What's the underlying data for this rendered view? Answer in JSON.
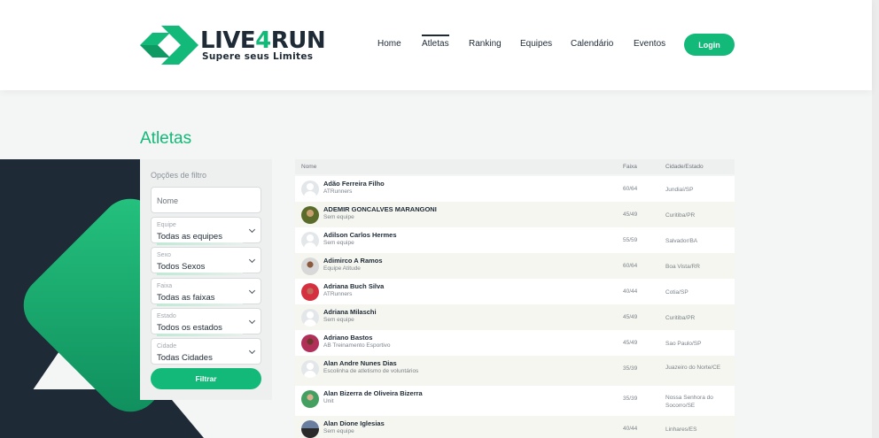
{
  "header": {
    "logo": {
      "name_part1": "LIVE",
      "name_part2": "4",
      "name_part3": "RUN",
      "tagline": "Supere seus Limites"
    },
    "nav": [
      "Home",
      "Atletas",
      "Ranking",
      "Equipes",
      "Calendário",
      "Eventos"
    ],
    "active_nav": "Atletas",
    "login_label": "Login"
  },
  "page": {
    "title": "Atletas"
  },
  "filters": {
    "title": "Opções de filtro",
    "name_placeholder": "Nome",
    "selects": [
      {
        "caption": "Equipe",
        "value": "Todas as equipes"
      },
      {
        "caption": "Sexo",
        "value": "Todos Sexos"
      },
      {
        "caption": "Faixa",
        "value": "Todas as faixas"
      },
      {
        "caption": "Estado",
        "value": "Todos os estados"
      },
      {
        "caption": "Cidade",
        "value": "Todas Cidades"
      }
    ],
    "submit_label": "Filtrar"
  },
  "table": {
    "headers": {
      "name": "Nome",
      "band": "Faixa",
      "city": "Cidade/Estado"
    },
    "rows": [
      {
        "name": "Adão Ferreira Filho",
        "team": "ATRunners",
        "band": "60/64",
        "city": "Jundiaí/SP"
      },
      {
        "name": "ADEMIR GONCALVES MARANGONI",
        "team": "Sem equipe",
        "band": "45/49",
        "city": "Curitiba/PR"
      },
      {
        "name": "Adilson Carlos Hermes",
        "team": "Sem equipe",
        "band": "55/59",
        "city": "Salvador/BA"
      },
      {
        "name": "Adimirco A Ramos",
        "team": "Equipe Atitude",
        "band": "60/64",
        "city": "Boa Vista/RR"
      },
      {
        "name": "Adriana Buch Silva",
        "team": "ATRunners",
        "band": "40/44",
        "city": "Cotia/SP"
      },
      {
        "name": "Adriana Milaschi",
        "team": "Sem equipe",
        "band": "45/49",
        "city": "Curitiba/PR"
      },
      {
        "name": "Adriano Bastos",
        "team": "AB Treinamento Esportivo",
        "band": "45/49",
        "city": "Sao Paulo/SP"
      },
      {
        "name": "Alan Andre Nunes Dias",
        "team": "Escolinha de atletismo de voluntários",
        "band": "35/39",
        "city": "Juazeiro do Norte/CE"
      },
      {
        "name": "Alan Bizerra de Oliveira Bizerra",
        "team": "Unit",
        "band": "35/39",
        "city": "Nossa Senhora do Socorro/SE"
      },
      {
        "name": "Alan Dione Iglesias",
        "team": "Sem equipe",
        "band": "40/44",
        "city": "Linhares/ES"
      }
    ]
  },
  "colors": {
    "brand_green": "#13b978",
    "dark_navy": "#1e2a36"
  },
  "icons": [
    "logo-arrow-icon",
    "chevron-down-icon",
    "user-placeholder-icon"
  ]
}
